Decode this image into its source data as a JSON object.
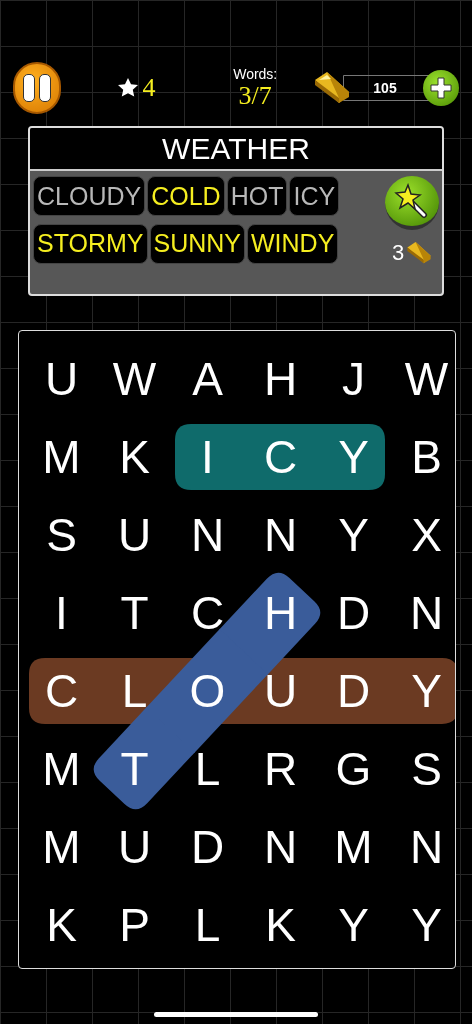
{
  "top_bar": {
    "stars": "4",
    "words_label": "Words:",
    "words_count": "3/7",
    "coins": "105"
  },
  "word_panel": {
    "category": "WEATHER",
    "hint_cost": "3",
    "words": [
      {
        "text": "CLOUDY",
        "found": true
      },
      {
        "text": "COLD",
        "found": false
      },
      {
        "text": "HOT",
        "found": true
      },
      {
        "text": "ICY",
        "found": true
      },
      {
        "text": "STORMY",
        "found": false
      },
      {
        "text": "SUNNY",
        "found": false
      },
      {
        "text": "WINDY",
        "found": false
      }
    ]
  },
  "grid": {
    "rows": [
      [
        {
          "letter": "U"
        },
        {
          "letter": "W"
        },
        {
          "letter": "A"
        },
        {
          "letter": "H"
        },
        {
          "letter": "J"
        },
        {
          "letter": "W"
        }
      ],
      [
        {
          "letter": "M"
        },
        {
          "letter": "K"
        },
        {
          "letter": "I",
          "highlights": [
            {
              "color": "#0f6b6b"
            }
          ]
        },
        {
          "letter": "C",
          "highlights": [
            {
              "color": "#0f6b6b"
            }
          ]
        },
        {
          "letter": "Y",
          "highlights": [
            {
              "color": "#0f6b6b"
            }
          ]
        },
        {
          "letter": "B"
        }
      ],
      [
        {
          "letter": "S"
        },
        {
          "letter": "U"
        },
        {
          "letter": "N"
        },
        {
          "letter": "N"
        },
        {
          "letter": "Y"
        },
        {
          "letter": "X"
        }
      ],
      [
        {
          "letter": "I"
        },
        {
          "letter": "T"
        },
        {
          "letter": "C"
        },
        {
          "letter": "H",
          "highlights": [
            {
              "color": "#3a5c9a"
            }
          ]
        },
        {
          "letter": "D"
        },
        {
          "letter": "N"
        }
      ],
      [
        {
          "letter": "C",
          "highlights": [
            {
              "color": "#6b3a22"
            }
          ]
        },
        {
          "letter": "L",
          "highlights": [
            {
              "color": "#6b3a22"
            }
          ]
        },
        {
          "letter": "O",
          "highlights": [
            {
              "color": "#6b3a22"
            },
            {
              "color": "#3a5c9a"
            }
          ]
        },
        {
          "letter": "U",
          "highlights": [
            {
              "color": "#6b3a22"
            }
          ]
        },
        {
          "letter": "D",
          "highlights": [
            {
              "color": "#6b3a22"
            }
          ]
        },
        {
          "letter": "Y",
          "highlights": [
            {
              "color": "#6b3a22"
            }
          ]
        }
      ],
      [
        {
          "letter": "M"
        },
        {
          "letter": "T",
          "highlights": [
            {
              "color": "#3a5c9a"
            }
          ]
        },
        {
          "letter": "L"
        },
        {
          "letter": "R"
        },
        {
          "letter": "G"
        },
        {
          "letter": "S"
        }
      ],
      [
        {
          "letter": "M"
        },
        {
          "letter": "U"
        },
        {
          "letter": "D"
        },
        {
          "letter": "N"
        },
        {
          "letter": "M"
        },
        {
          "letter": "N"
        }
      ],
      [
        {
          "letter": "K"
        },
        {
          "letter": "P"
        },
        {
          "letter": "L"
        },
        {
          "letter": "K"
        },
        {
          "letter": "Y"
        },
        {
          "letter": "Y"
        }
      ]
    ]
  }
}
